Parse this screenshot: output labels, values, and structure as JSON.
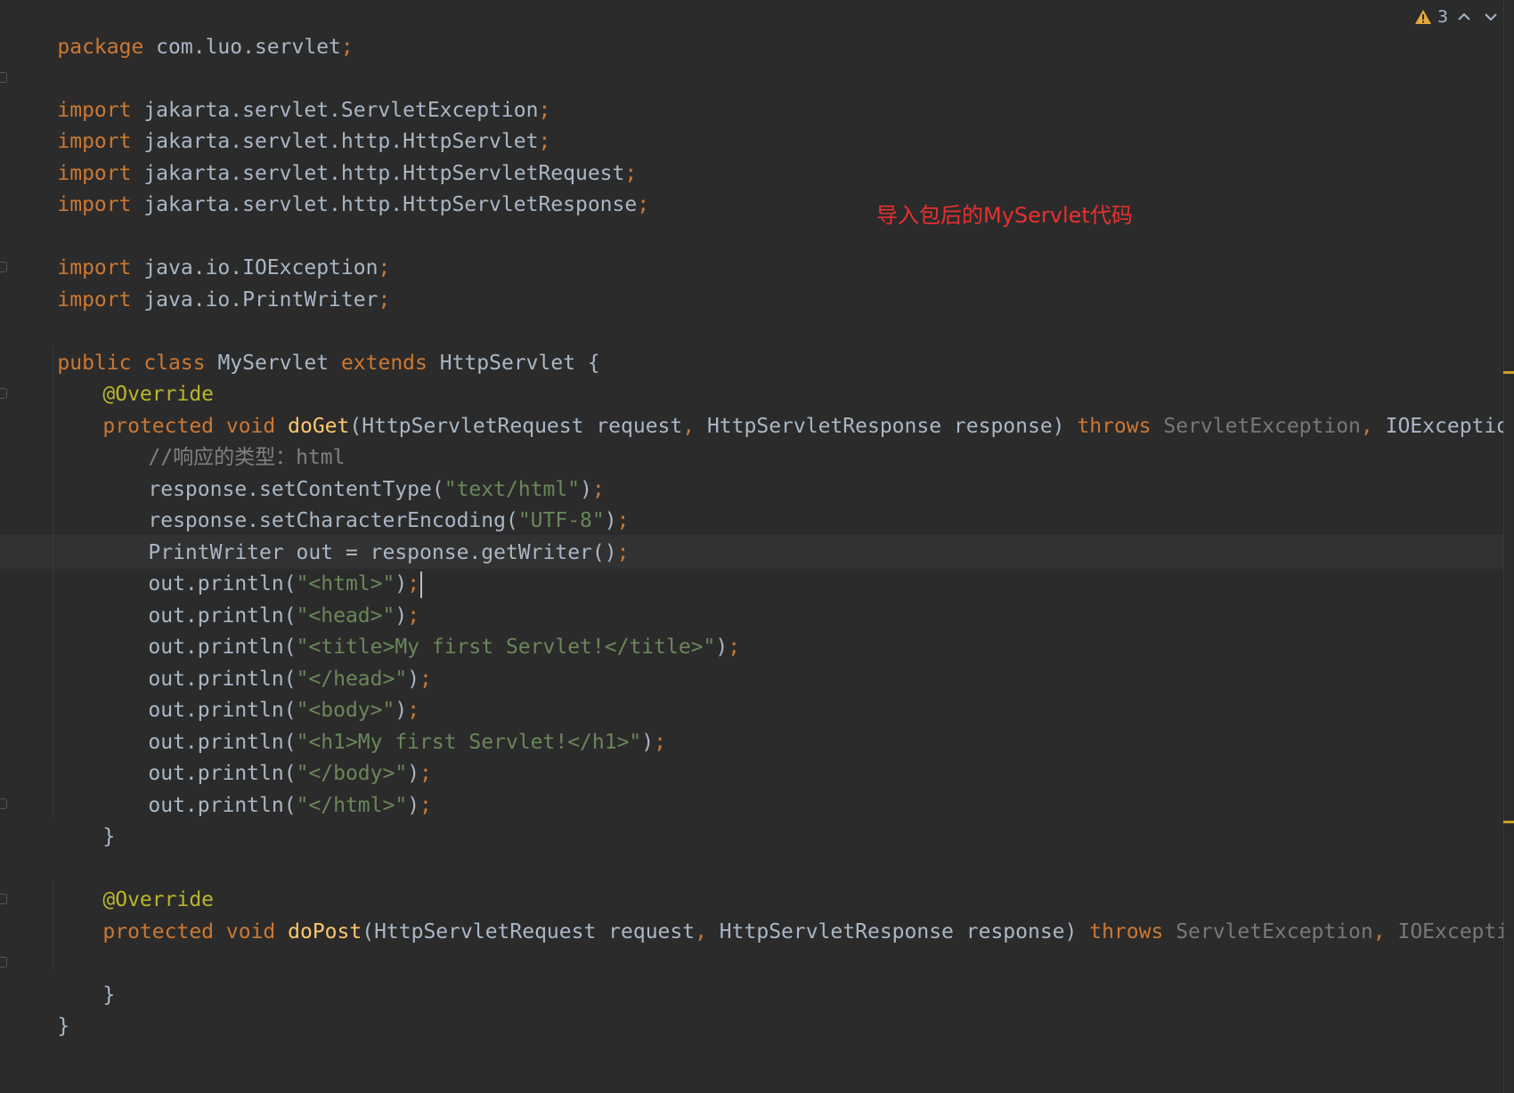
{
  "inspection": {
    "warning_count": "3"
  },
  "annotation_note": "导入包后的MyServlet代码",
  "code": {
    "package": {
      "kw": "package",
      "name": " com.luo.servlet",
      "semi": ";"
    },
    "imports": [
      {
        "kw": "import",
        "name": " jakarta.servlet.ServletException",
        "semi": ";"
      },
      {
        "kw": "import",
        "name": " jakarta.servlet.http.HttpServlet",
        "semi": ";"
      },
      {
        "kw": "import",
        "name": " jakarta.servlet.http.HttpServletRequest",
        "semi": ";"
      },
      {
        "kw": "import",
        "name": " jakarta.servlet.http.HttpServletResponse",
        "semi": ";"
      },
      {
        "kw": "import",
        "name": " java.io.IOException",
        "semi": ";"
      },
      {
        "kw": "import",
        "name": " java.io.PrintWriter",
        "semi": ";"
      }
    ],
    "class_decl": {
      "public": "public",
      "class": "class",
      "name": "MyServlet",
      "extends": "extends",
      "parent": "HttpServlet",
      "brace": "{"
    },
    "doget": {
      "annotation": "@Override",
      "protected": "protected",
      "void": "void",
      "name": "doGet",
      "params_a": "(HttpServletRequest request",
      "comma1": ",",
      "params_b": " HttpServletResponse response)",
      "throws": "throws",
      "ex1": "ServletException",
      "comma2": ",",
      "ex2": " IOException {",
      "comment": "//响应的类型：html",
      "close": "}"
    },
    "body_lines": [
      {
        "pre": "response.setContentType(",
        "str": "\"text/html\"",
        "post": ")",
        "semi": ";"
      },
      {
        "pre": "response.setCharacterEncoding(",
        "str": "\"UTF-8\"",
        "post": ")",
        "semi": ";"
      },
      {
        "pre": "PrintWriter out = response.getWriter()",
        "str": "",
        "post": "",
        "semi": ";"
      },
      {
        "pre": "out.println(",
        "str": "\"<html>\"",
        "post": ")",
        "semi": ";"
      },
      {
        "pre": "out.println(",
        "str": "\"<head>\"",
        "post": ")",
        "semi": ";"
      },
      {
        "pre": "out.println(",
        "str": "\"<title>My first Servlet!</title>\"",
        "post": ")",
        "semi": ";"
      },
      {
        "pre": "out.println(",
        "str": "\"</head>\"",
        "post": ")",
        "semi": ";"
      },
      {
        "pre": "out.println(",
        "str": "\"<body>\"",
        "post": ")",
        "semi": ";"
      },
      {
        "pre": "out.println(",
        "str": "\"<h1>My first Servlet!</h1>\"",
        "post": ")",
        "semi": ";"
      },
      {
        "pre": "out.println(",
        "str": "\"</body>\"",
        "post": ")",
        "semi": ";"
      },
      {
        "pre": "out.println(",
        "str": "\"</html>\"",
        "post": ")",
        "semi": ";"
      }
    ],
    "dopost": {
      "annotation": "@Override",
      "protected": "protected",
      "void": "void",
      "name": "doPost",
      "params_a": "(HttpServletRequest request",
      "comma1": ",",
      "params_b": " HttpServletResponse response)",
      "throws": "throws",
      "ex1": "ServletException",
      "comma2": ",",
      "ex2": "IOException",
      "close": "}"
    },
    "class_close": "}"
  }
}
